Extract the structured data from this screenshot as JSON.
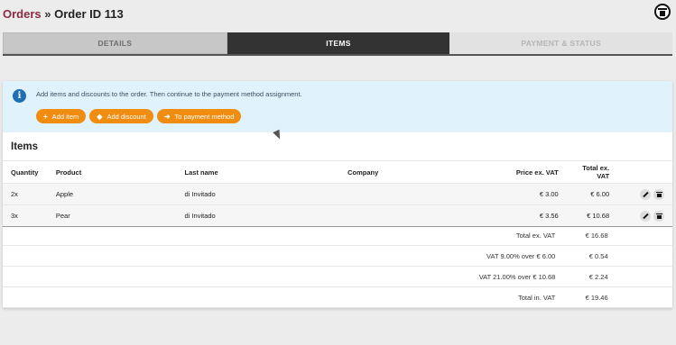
{
  "breadcrumb": {
    "section": "Orders",
    "separator": " » ",
    "current": "Order ID 113"
  },
  "tabs": [
    {
      "label": "DETAILS",
      "state": "inactive"
    },
    {
      "label": "ITEMS",
      "state": "active"
    },
    {
      "label": "PAYMENT & STATUS",
      "state": "disabled"
    }
  ],
  "info": {
    "text": "Add items and discounts to the order. Then continue to the payment method assignment.",
    "buttons": {
      "add_item": "Add item",
      "add_discount": "Add discount",
      "to_payment": "To payment method"
    }
  },
  "items_title": "Items",
  "table": {
    "headers": {
      "quantity": "Quantity",
      "product": "Product",
      "last_name": "Last name",
      "company": "Company",
      "price": "Price ex. VAT",
      "total": "Total ex. VAT"
    },
    "rows": [
      {
        "quantity": "2x",
        "product": "Apple",
        "last_name": "di Invitado",
        "company": "",
        "price": "€ 3.00",
        "total": "€ 6.00"
      },
      {
        "quantity": "3x",
        "product": "Pear",
        "last_name": "di Invitado",
        "company": "",
        "price": "€ 3.56",
        "total": "€ 10.68"
      }
    ]
  },
  "totals": [
    {
      "label": "Total ex. VAT",
      "value": "€ 16.68"
    },
    {
      "label": "VAT 9.00% over € 6.00",
      "value": "€ 0.54"
    },
    {
      "label": "VAT 21.00% over € 10.68",
      "value": "€ 2.24"
    },
    {
      "label": "Total in. VAT",
      "value": "€ 19.46"
    }
  ],
  "colors": {
    "accent": "#f08c10",
    "brand": "#8a2b45",
    "info_bg": "#e0f2fb",
    "active_tab": "#333333"
  }
}
